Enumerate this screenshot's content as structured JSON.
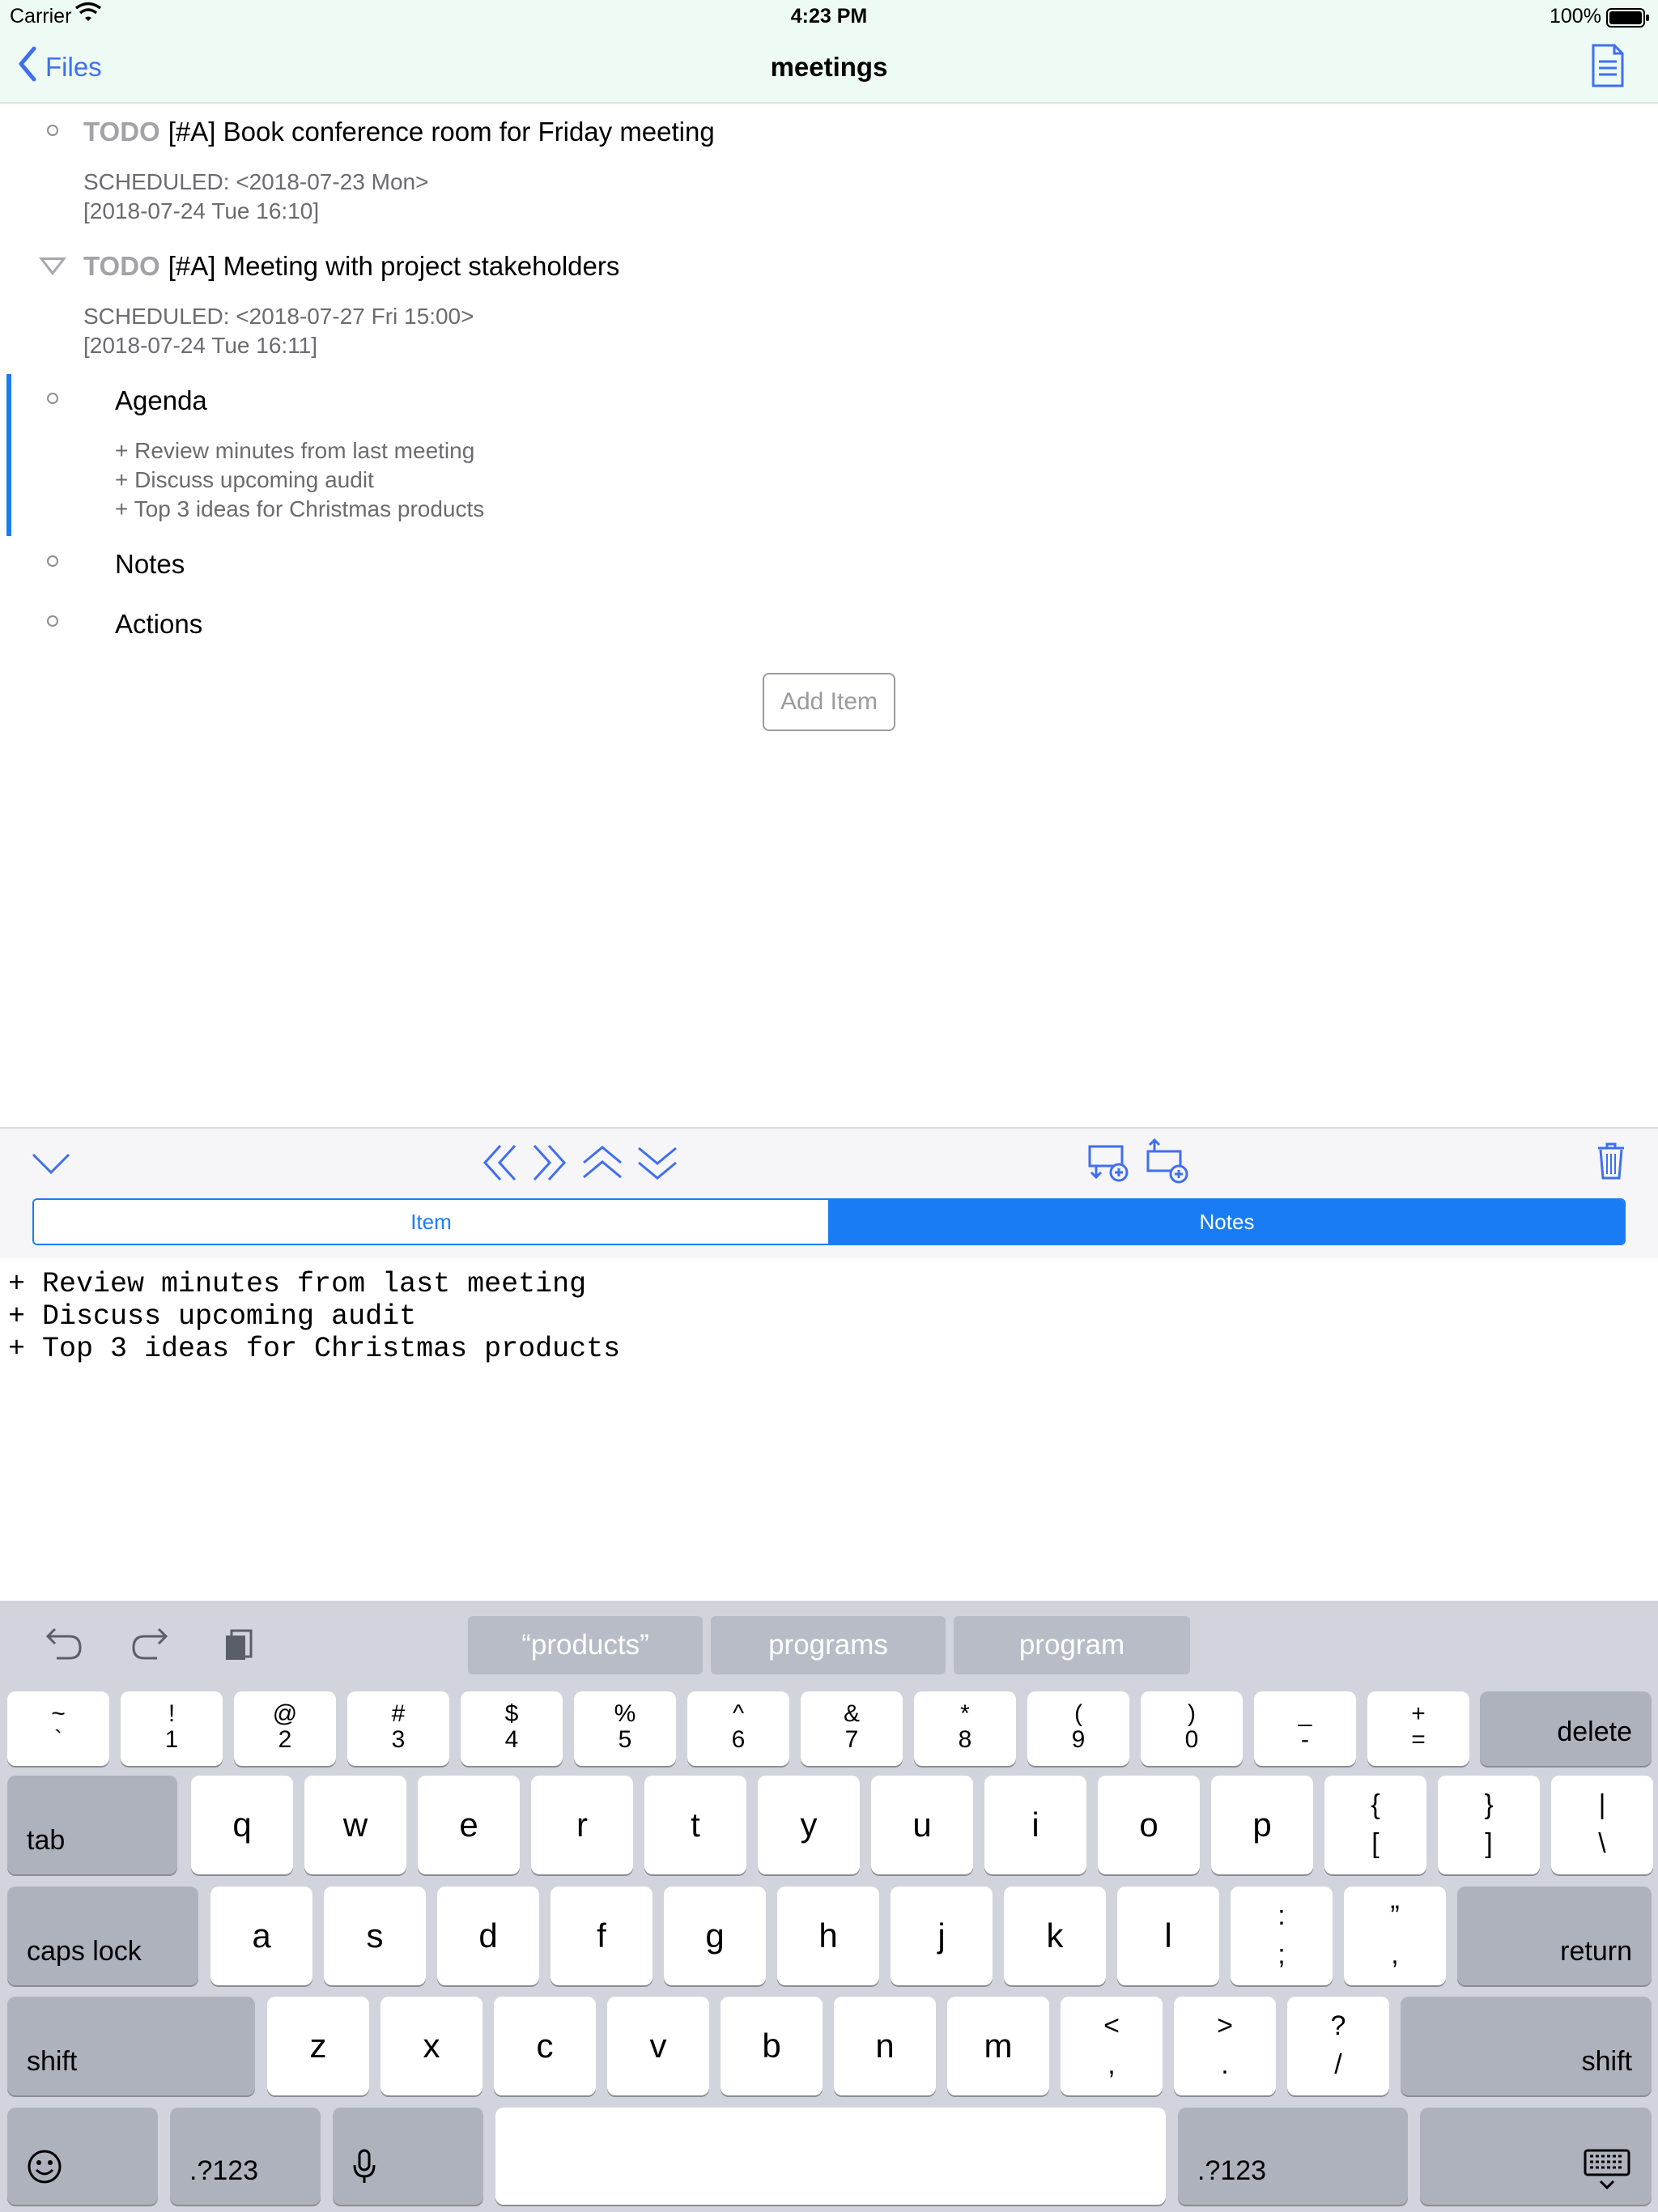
{
  "status_bar": {
    "carrier": "Carrier",
    "time": "4:23 PM",
    "battery": "100%"
  },
  "nav": {
    "back_label": "Files",
    "title": "meetings"
  },
  "outline": {
    "item1": {
      "todo": "TODO",
      "title": "[#A] Book conference room for Friday meeting",
      "scheduled": "SCHEDULED: <2018-07-23 Mon>",
      "timestamp": "[2018-07-24 Tue 16:10]"
    },
    "item2": {
      "todo": "TODO",
      "title": "[#A] Meeting with project stakeholders",
      "scheduled": "SCHEDULED: <2018-07-27 Fri 15:00>",
      "timestamp": "[2018-07-24 Tue 16:11]"
    },
    "agenda": {
      "title": "Agenda",
      "notes": [
        "+ Review minutes from last meeting",
        "+ Discuss upcoming audit",
        "+ Top 3 ideas for Christmas products"
      ]
    },
    "notes_item": {
      "title": "Notes"
    },
    "actions_item": {
      "title": "Actions"
    },
    "add_item_label": "Add Item"
  },
  "editor": {
    "tabs": [
      "Item",
      "Notes"
    ],
    "active_tab": "Notes",
    "accent_color": "#1a7cf5",
    "text_lines": [
      "+ Review minutes from last meeting",
      "+ Discuss upcoming audit",
      "+ Top 3 ideas for Christmas products"
    ]
  },
  "keyboard": {
    "suggestions": [
      "“products”",
      "programs",
      "program"
    ],
    "number_row": [
      {
        "top": "~",
        "bottom": "`"
      },
      {
        "top": "!",
        "bottom": "1"
      },
      {
        "top": "@",
        "bottom": "2"
      },
      {
        "top": "#",
        "bottom": "3"
      },
      {
        "top": "$",
        "bottom": "4"
      },
      {
        "top": "%",
        "bottom": "5"
      },
      {
        "top": "^",
        "bottom": "6"
      },
      {
        "top": "&",
        "bottom": "7"
      },
      {
        "top": "*",
        "bottom": "8"
      },
      {
        "top": "(",
        "bottom": "9"
      },
      {
        "top": ")",
        "bottom": "0"
      },
      {
        "top": "_",
        "bottom": "-"
      },
      {
        "top": "+",
        "bottom": "="
      }
    ],
    "delete": "delete",
    "tab": "tab",
    "row_q": [
      "q",
      "w",
      "e",
      "r",
      "t",
      "y",
      "u",
      "i",
      "o",
      "p"
    ],
    "row_q_symbols": [
      {
        "top": "{",
        "bottom": "["
      },
      {
        "top": "}",
        "bottom": "]"
      },
      {
        "top": "|",
        "bottom": "\\"
      }
    ],
    "caps_lock": "caps lock",
    "row_a": [
      "a",
      "s",
      "d",
      "f",
      "g",
      "h",
      "j",
      "k",
      "l"
    ],
    "row_a_symbols": [
      {
        "top": ":",
        "bottom": ";"
      },
      {
        "top": "”",
        "bottom": ","
      }
    ],
    "return": "return",
    "shift": "shift",
    "row_z": [
      "z",
      "x",
      "c",
      "v",
      "b",
      "n",
      "m"
    ],
    "row_z_symbols": [
      {
        "top": "<",
        "bottom": ","
      },
      {
        "top": ">",
        "bottom": "."
      },
      {
        "top": "?",
        "bottom": "/"
      }
    ],
    "numbers_label": ".?123",
    "icons": [
      "undo-icon",
      "redo-icon",
      "paste-icon",
      "emoji-icon",
      "microphone-icon",
      "keyboard-dismiss-icon"
    ]
  }
}
